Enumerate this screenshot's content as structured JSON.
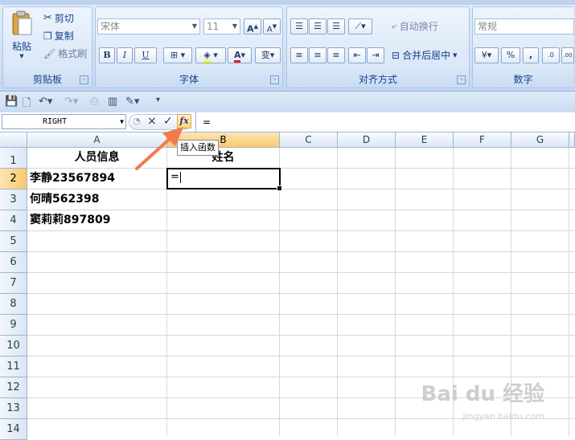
{
  "ribbon": {
    "clipboard": {
      "label": "剪贴板",
      "paste": "粘贴",
      "cut": "剪切",
      "copy": "复制",
      "format_painter": "格式刷"
    },
    "font": {
      "label": "字体",
      "font_name": "宋体",
      "font_size": "11",
      "bold": "B",
      "italic": "I",
      "underline": "U",
      "grow": "A",
      "shrink": "A"
    },
    "alignment": {
      "label": "对齐方式",
      "wrap_text": "自动换行",
      "merge_center": "合并后居中"
    },
    "number": {
      "label": "数字",
      "format": "常规",
      "percent": "%",
      "comma": ",",
      "increase_decimal": ".0",
      "decrease_decimal": ".00"
    }
  },
  "formula_bar": {
    "name_box": "RIGHT",
    "cancel": "×",
    "enter": "✓",
    "fx": "fx",
    "content": "="
  },
  "tooltip": "插入函数",
  "sheet": {
    "columns": [
      "A",
      "B",
      "C",
      "D",
      "E",
      "F",
      "G"
    ],
    "rows": [
      "1",
      "2",
      "3",
      "4",
      "5",
      "6",
      "7",
      "8",
      "9",
      "10",
      "11",
      "12",
      "13",
      "14"
    ],
    "cells": {
      "A1": "人员信息",
      "B1": "姓名",
      "A2": "李静23567894",
      "A3": "何晴562398",
      "A4": "窦莉莉897809",
      "B2": "="
    }
  },
  "watermark": {
    "text": "Bai du 经验",
    "sub": "jingyan.baidu.com"
  }
}
